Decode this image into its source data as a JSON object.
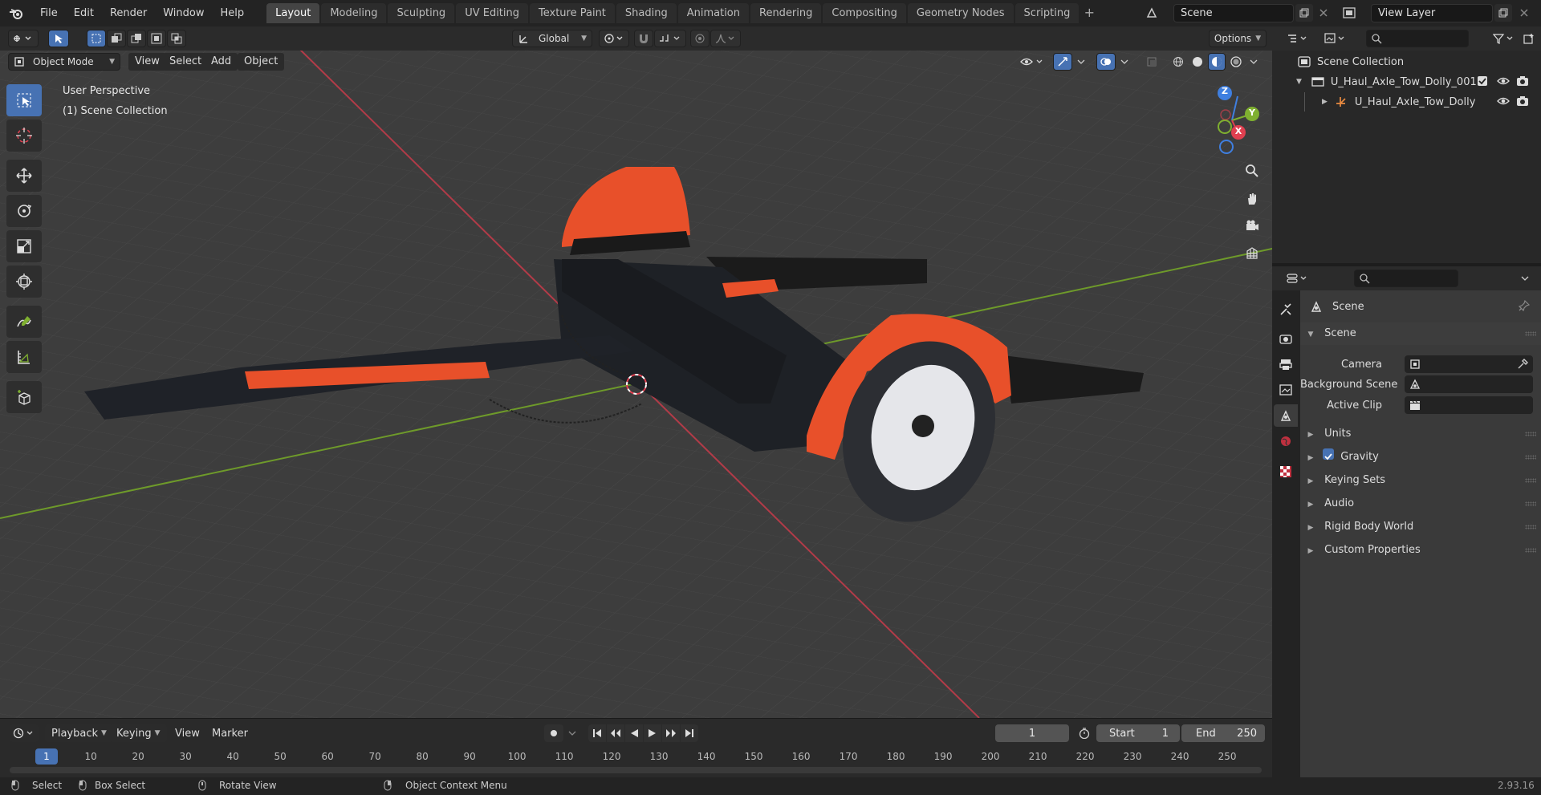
{
  "menu": [
    "File",
    "Edit",
    "Render",
    "Window",
    "Help"
  ],
  "workspaces": [
    "Layout",
    "Modeling",
    "Sculpting",
    "UV Editing",
    "Texture Paint",
    "Shading",
    "Animation",
    "Rendering",
    "Compositing",
    "Geometry Nodes",
    "Scripting"
  ],
  "active_workspace": "Layout",
  "scene_field": "Scene",
  "view_layer_field": "View Layer",
  "viewport_header": {
    "transform_orientation": "Global",
    "options": "Options",
    "mode": "Object Mode",
    "menus": [
      "View",
      "Select",
      "Add",
      "Object"
    ]
  },
  "viewport": {
    "perspective": "User Perspective",
    "collection": "(1) Scene Collection",
    "gizmo": {
      "z": "Z",
      "y": "Y",
      "x": "X"
    }
  },
  "timeline": {
    "menus": [
      "Playback",
      "Keying",
      "View",
      "Marker"
    ],
    "current_frame": "1",
    "start_label": "Start",
    "start": "1",
    "end_label": "End",
    "end": "250",
    "ruler": [
      "1",
      "10",
      "20",
      "30",
      "40",
      "50",
      "60",
      "70",
      "80",
      "90",
      "100",
      "110",
      "120",
      "130",
      "140",
      "150",
      "160",
      "170",
      "180",
      "190",
      "200",
      "210",
      "220",
      "230",
      "240",
      "250"
    ]
  },
  "statusbar": {
    "select": "Select",
    "box_select": "Box Select",
    "rotate": "Rotate View",
    "context": "Object Context Menu",
    "version": "2.93.16"
  },
  "outliner": {
    "root": "Scene Collection",
    "items": [
      {
        "name": "U_Haul_Axle_Tow_Dolly_001"
      },
      {
        "name": "U_Haul_Axle_Tow_Dolly"
      }
    ]
  },
  "properties": {
    "context_label": "Scene",
    "panel_title": "Scene",
    "camera_label": "Camera",
    "bg_scene_label": "Background Scene",
    "active_clip_label": "Active Clip",
    "sections": [
      "Units",
      "Gravity",
      "Keying Sets",
      "Audio",
      "Rigid Body World",
      "Custom Properties"
    ]
  },
  "colors": {
    "accent": "#4772b3",
    "x_axis": "#e04050",
    "y_axis": "#7fb030",
    "z_axis": "#3f7fe0",
    "dolly_orange": "#e8502a"
  }
}
